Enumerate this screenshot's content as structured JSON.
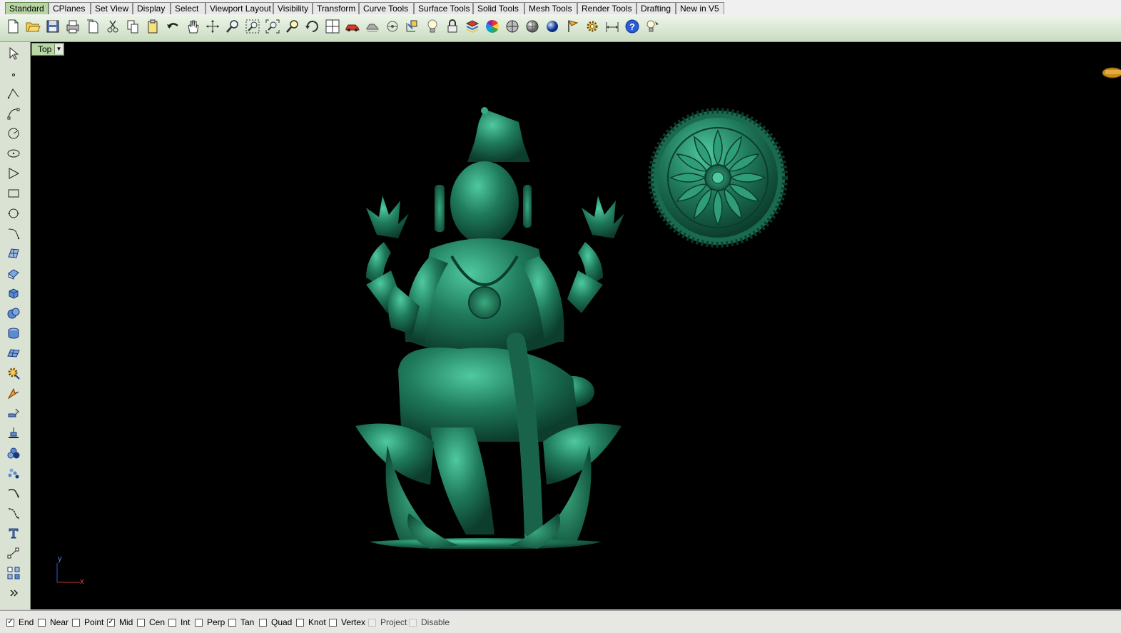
{
  "tabs": [
    {
      "label": "Standard",
      "active": true
    },
    {
      "label": "CPlanes"
    },
    {
      "label": "Set View"
    },
    {
      "label": "Display"
    },
    {
      "label": "Select"
    },
    {
      "label": "Viewport Layout"
    },
    {
      "label": "Visibility"
    },
    {
      "label": "Transform"
    },
    {
      "label": "Curve Tools"
    },
    {
      "label": "Surface Tools"
    },
    {
      "label": "Solid Tools"
    },
    {
      "label": "Mesh Tools"
    },
    {
      "label": "Render Tools"
    },
    {
      "label": "Drafting"
    },
    {
      "label": "New in V5"
    }
  ],
  "toolbar_icons": [
    "new-file-icon",
    "open-folder-icon",
    "save-icon",
    "print-icon",
    "paste-page-icon",
    "cut-icon",
    "copy-icon",
    "clipboard-icon",
    "undo-icon",
    "pan-hand-icon",
    "rotate-view-icon",
    "zoom-dynamic-icon",
    "zoom-window-icon",
    "zoom-extents-icon",
    "zoom-selected-icon",
    "rotate-view-arrows-icon",
    "four-viewports-icon",
    "car-icon",
    "hide-objects-icon",
    "show-objects-icon",
    "cplane-icon",
    "light-bulb-icon",
    "lock-icon",
    "layer-book-icon",
    "color-wheel-icon",
    "sphere-shaded-icon",
    "sphere-rendered-icon",
    "blue-sphere-icon",
    "render-flag-icon",
    "options-gear-icon",
    "dimension-icon",
    "help-icon",
    "tool-tips-icon"
  ],
  "left_icons": [
    "select-arrow-icon",
    "point-icon",
    "polyline-icon",
    "curve-control-points-icon",
    "circle-icon",
    "ellipse-icon",
    "polygon-icon",
    "rectangle-icon",
    "arc-icon",
    "curve-fillet-icon",
    "surface-points-icon",
    "extrude-surface-icon",
    "solid-box-icon",
    "boolean-union-icon",
    "solid-cylinder-icon",
    "mesh-icon",
    "gear-transform-icon",
    "render-arrow-icon",
    "drafting-tool-icon",
    "edit-tool-icon",
    "group-icon",
    "array-icon",
    "curve-from-object-icon",
    "fillet-curve-icon",
    "text-icon",
    "scale-icon",
    "array-grid-icon",
    "more-chevron-icon"
  ],
  "viewport": {
    "label": "Top",
    "background": "#000000",
    "model_color": "#1f7a5c",
    "axis": {
      "x": "x",
      "y": "y"
    }
  },
  "osnaps": [
    {
      "label": "End",
      "checked": true
    },
    {
      "label": "Near",
      "checked": false
    },
    {
      "label": "Point",
      "checked": false
    },
    {
      "label": "Mid",
      "checked": true
    },
    {
      "label": "Cen",
      "checked": false
    },
    {
      "label": "Int",
      "checked": false
    },
    {
      "label": "Perp",
      "checked": false
    },
    {
      "label": "Tan",
      "checked": false
    },
    {
      "label": "Quad",
      "checked": false
    },
    {
      "label": "Knot",
      "checked": false
    },
    {
      "label": "Vertex",
      "checked": false
    },
    {
      "label": "Project",
      "checked": false,
      "disabled": true
    },
    {
      "label": "Disable",
      "checked": false,
      "disabled": true
    }
  ]
}
